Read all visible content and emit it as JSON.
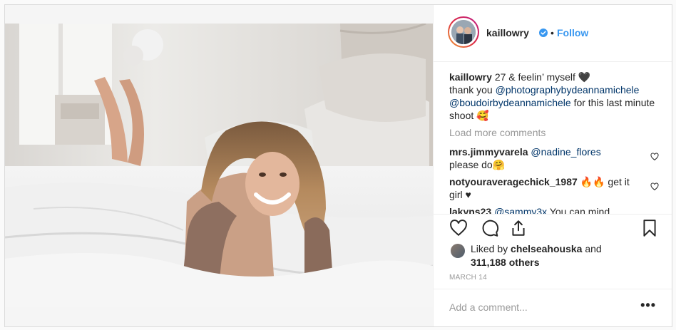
{
  "post": {
    "image_alt": "photo",
    "username": "kaillowry",
    "dot": "•",
    "follow_label": "Follow",
    "caption": {
      "user": "kaillowry",
      "line1_text": "27 & feelin’ myself",
      "line1_emoji": "🖤",
      "thank_you": "thank you",
      "mention1": "@photographybydeannamichele",
      "mention2": "@boudoirbydeannamichele",
      "tail": "for this last minute shoot",
      "tail_emoji": "🥰"
    },
    "load_more": "Load more comments",
    "comments": [
      {
        "user": "mrs.jimmyvarela",
        "mention": "@nadine_flores",
        "text": "please do",
        "emoji": "🤗"
      },
      {
        "user": "notyouraveragechick_1987",
        "emoji": "🔥🔥",
        "text": "get it girl ♥"
      },
      {
        "user": "lakyns23",
        "mention": "@sammy3x",
        "text": "You can mind"
      }
    ],
    "likes": {
      "prefix": "Liked by",
      "user": "chelseahouska",
      "and": "and",
      "count": "311,188 others"
    },
    "date": "MARCH 14",
    "add_comment_placeholder": "Add a comment...",
    "more_label": "•••",
    "colors": {
      "link_blue": "#3897f0",
      "mention": "#003569",
      "muted": "#999999"
    },
    "icons": [
      "verified-badge-icon",
      "heart-icon",
      "comment-icon",
      "share-icon",
      "bookmark-icon",
      "more-options-icon"
    ]
  }
}
